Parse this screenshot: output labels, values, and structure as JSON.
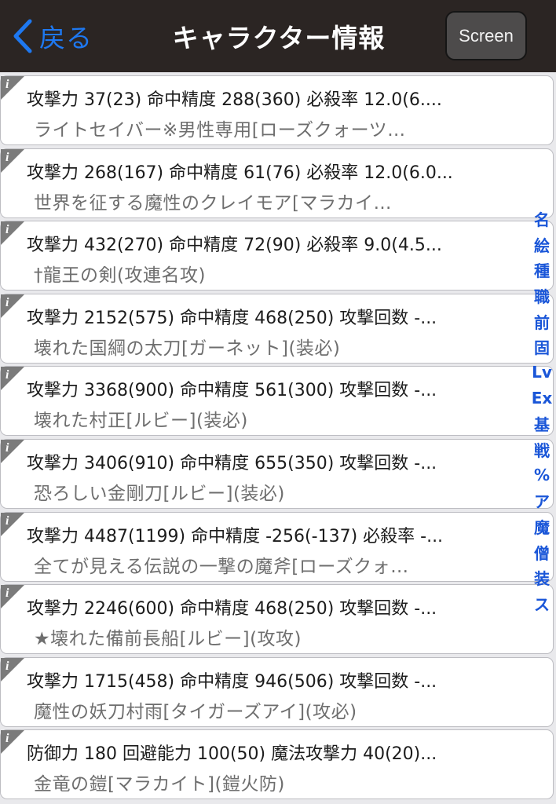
{
  "navbar": {
    "back_label": "戻る",
    "title": "キャラクター情報",
    "screen_button": "Screen"
  },
  "colors": {
    "navbar_bg": "#2b2523",
    "accent": "#1e78f0",
    "index_text": "#1a56d8"
  },
  "items": [
    {
      "icon": "info-icon",
      "stats": "攻撃力 37(23) 命中精度 288(360) 必殺率 12.0(6....",
      "name": "ライトセイバー※男性専用[ローズクォーツ…"
    },
    {
      "icon": "info-icon",
      "stats": "攻撃力 268(167) 命中精度 61(76) 必殺率 12.0(6.0...",
      "name": "世界を征する魔性のクレイモア[マラカイ…"
    },
    {
      "icon": "info-icon",
      "stats": "攻撃力 432(270) 命中精度 72(90) 必殺率 9.0(4.5...",
      "name": "†龍王の剣(攻連名攻)"
    },
    {
      "icon": "info-icon",
      "stats": "攻撃力 2152(575) 命中精度 468(250) 攻撃回数 -...",
      "name": "壊れた国綱の太刀[ガーネット](装必)"
    },
    {
      "icon": "info-icon",
      "stats": "攻撃力 3368(900) 命中精度 561(300) 攻撃回数 -...",
      "name": "壊れた村正[ルビー](装必)"
    },
    {
      "icon": "info-icon",
      "stats": "攻撃力 3406(910) 命中精度 655(350) 攻撃回数 -...",
      "name": "恐ろしい金剛刀[ルビー](装必)"
    },
    {
      "icon": "info-icon",
      "stats": "攻撃力 4487(1199) 命中精度 -256(-137) 必殺率 -...",
      "name": "全てが見える伝説の一撃の魔斧[ローズクォ…"
    },
    {
      "icon": "info-icon",
      "stats": "攻撃力 2246(600) 命中精度 468(250) 攻撃回数 -...",
      "name": "★壊れた備前長船[ルビー](攻攻)"
    },
    {
      "icon": "info-icon",
      "stats": "攻撃力 1715(458) 命中精度 946(506) 攻撃回数 -...",
      "name": "魔性の妖刀村雨[タイガーズアイ](攻必)"
    },
    {
      "icon": "info-icon",
      "stats": "防御力 180 回避能力 100(50) 魔法攻撃力 40(20)...",
      "name": "金竜の鎧[マラカイト](鎧火防)"
    }
  ],
  "section_index": [
    "名",
    "絵",
    "種",
    "職",
    "前",
    "固",
    "Lv",
    "Ex",
    "基",
    "戦",
    "%",
    "ア",
    "魔",
    "僧",
    "装",
    "ス"
  ]
}
